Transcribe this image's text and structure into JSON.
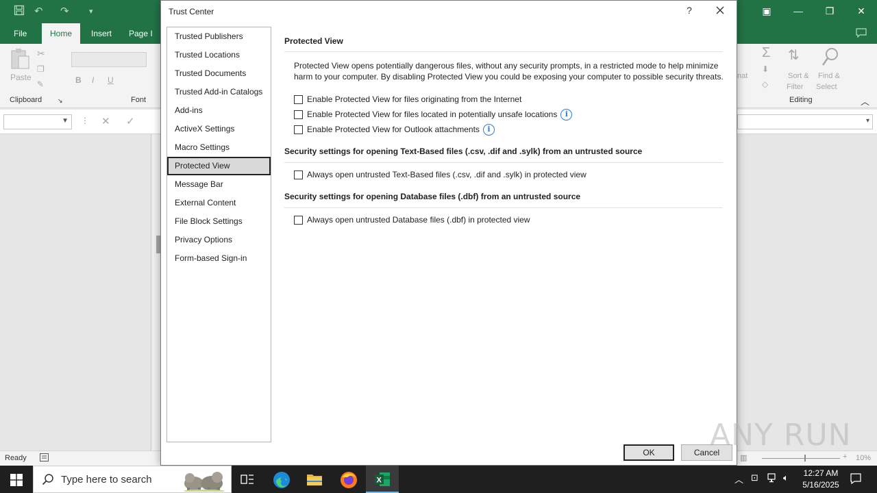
{
  "excel": {
    "tabs": {
      "file": "File",
      "home": "Home",
      "insert": "Insert",
      "page": "Page I"
    },
    "ribbon": {
      "paste": "Paste",
      "clipboard": "Clipboard",
      "font": "Font",
      "editing": "Editing",
      "sort_filter_1": "Sort &",
      "sort_filter_2": "Filter",
      "find_select_1": "Find &",
      "find_select_2": "Select",
      "format_partial": "nat"
    },
    "status": {
      "ready": "Ready",
      "zoom": "10%"
    }
  },
  "dialog": {
    "title": "Trust Center",
    "help": "?",
    "nav": [
      "Trusted Publishers",
      "Trusted Locations",
      "Trusted Documents",
      "Trusted Add-in Catalogs",
      "Add-ins",
      "ActiveX Settings",
      "Macro Settings",
      "Protected View",
      "Message Bar",
      "External Content",
      "File Block Settings",
      "Privacy Options",
      "Form-based Sign-in"
    ],
    "protected_view": {
      "heading": "Protected View",
      "description": "Protected View opens potentially dangerous files, without any security prompts, in a restricted mode to help minimize harm to your computer. By disabling Protected View you could be exposing your computer to possible security threats.",
      "options": [
        "Enable Protected View for files originating from the Internet",
        "Enable Protected View for files located in potentially unsafe locations",
        "Enable Protected View for Outlook attachments"
      ]
    },
    "text_based": {
      "heading": "Security settings for opening Text-Based files (.csv, .dif and .sylk) from an untrusted source",
      "option": "Always open untrusted Text-Based files (.csv, .dif and .sylk) in protected view"
    },
    "database": {
      "heading": "Security settings for opening Database files (.dbf) from an untrusted source",
      "option": "Always open untrusted Database files (.dbf) in protected view"
    },
    "ok": "OK",
    "cancel": "Cancel"
  },
  "taskbar": {
    "search_placeholder": "Type here to search",
    "time": "12:27 AM",
    "date": "5/16/2025"
  },
  "watermark": "ANY RUN",
  "colors": {
    "excel_green": "#217346",
    "info_blue": "#2b7cd3",
    "taskbar": "#1f1f1f"
  }
}
